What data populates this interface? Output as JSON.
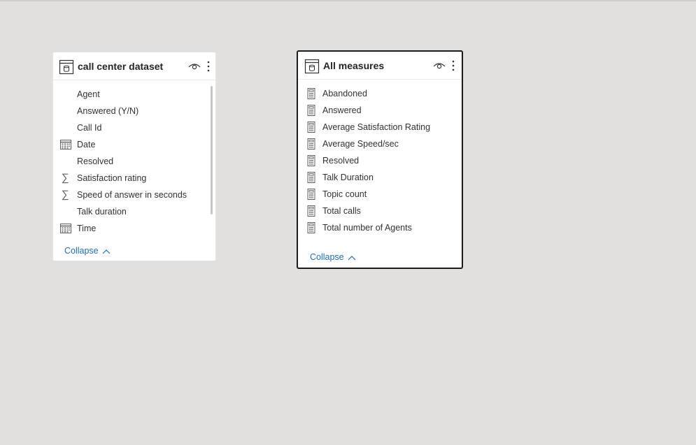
{
  "cards": [
    {
      "title": "call center dataset",
      "fields": [
        {
          "label": "Agent",
          "icon": "none"
        },
        {
          "label": "Answered (Y/N)",
          "icon": "none"
        },
        {
          "label": "Call Id",
          "icon": "none"
        },
        {
          "label": "Date",
          "icon": "calendar-icon"
        },
        {
          "label": "Resolved",
          "icon": "none"
        },
        {
          "label": "Satisfaction rating",
          "icon": "sigma-icon"
        },
        {
          "label": "Speed of answer in seconds",
          "icon": "sigma-icon"
        },
        {
          "label": "Talk duration",
          "icon": "none"
        },
        {
          "label": "Time",
          "icon": "calendar-icon"
        }
      ],
      "collapse_label": "Collapse"
    },
    {
      "title": "All measures",
      "fields": [
        {
          "label": "Abandoned",
          "icon": "calculator-icon"
        },
        {
          "label": "Answered",
          "icon": "calculator-icon"
        },
        {
          "label": "Average Satisfaction Rating",
          "icon": "calculator-icon"
        },
        {
          "label": "Average Speed/sec",
          "icon": "calculator-icon"
        },
        {
          "label": "Resolved",
          "icon": "calculator-icon"
        },
        {
          "label": "Talk Duration",
          "icon": "calculator-icon"
        },
        {
          "label": "Topic count",
          "icon": "calculator-icon"
        },
        {
          "label": "Total calls",
          "icon": "calculator-icon"
        },
        {
          "label": "Total number of Agents",
          "icon": "calculator-icon"
        }
      ],
      "collapse_label": "Collapse"
    }
  ],
  "colors": {
    "canvas": "#e1e0df",
    "link": "#1f6fb5",
    "selected_border": "#1b1a19"
  }
}
